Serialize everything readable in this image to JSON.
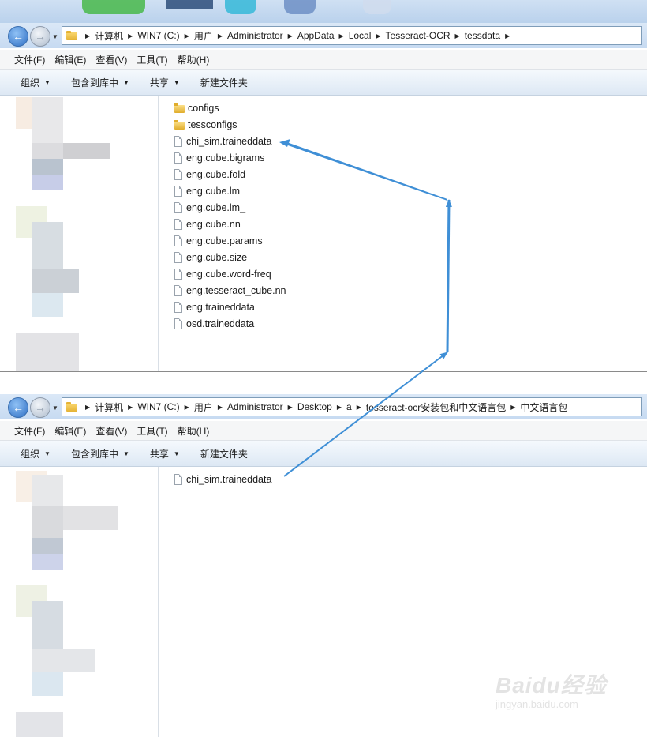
{
  "window_top": {
    "breadcrumb": [
      "计算机",
      "WIN7 (C:)",
      "用户",
      "Administrator",
      "AppData",
      "Local",
      "Tesseract-OCR",
      "tessdata"
    ],
    "menu": [
      "文件(F)",
      "编辑(E)",
      "查看(V)",
      "工具(T)",
      "帮助(H)"
    ],
    "toolbar": {
      "organize": "组织",
      "include_library": "包含到库中",
      "share": "共享",
      "new_folder": "新建文件夹"
    },
    "files": [
      {
        "name": "configs",
        "type": "folder"
      },
      {
        "name": "tessconfigs",
        "type": "folder"
      },
      {
        "name": "chi_sim.traineddata",
        "type": "file"
      },
      {
        "name": "eng.cube.bigrams",
        "type": "file"
      },
      {
        "name": "eng.cube.fold",
        "type": "file"
      },
      {
        "name": "eng.cube.lm",
        "type": "file"
      },
      {
        "name": "eng.cube.lm_",
        "type": "file"
      },
      {
        "name": "eng.cube.nn",
        "type": "file"
      },
      {
        "name": "eng.cube.params",
        "type": "file"
      },
      {
        "name": "eng.cube.size",
        "type": "file"
      },
      {
        "name": "eng.cube.word-freq",
        "type": "file"
      },
      {
        "name": "eng.tesseract_cube.nn",
        "type": "file"
      },
      {
        "name": "eng.traineddata",
        "type": "file"
      },
      {
        "name": "osd.traineddata",
        "type": "file"
      }
    ]
  },
  "window_bottom": {
    "breadcrumb": [
      "计算机",
      "WIN7 (C:)",
      "用户",
      "Administrator",
      "Desktop",
      "a",
      "tesseract-ocr安装包和中文语言包",
      "中文语言包"
    ],
    "menu": [
      "文件(F)",
      "编辑(E)",
      "查看(V)",
      "工具(T)",
      "帮助(H)"
    ],
    "toolbar": {
      "organize": "组织",
      "include_library": "包含到库中",
      "share": "共享",
      "new_folder": "新建文件夹"
    },
    "files": [
      {
        "name": "chi_sim.traineddata",
        "type": "file"
      }
    ]
  },
  "annotation": {
    "arrow_color": "#3f8fd6"
  },
  "watermark": {
    "logo": "Baidu经验",
    "url": "jingyan.baidu.com"
  }
}
